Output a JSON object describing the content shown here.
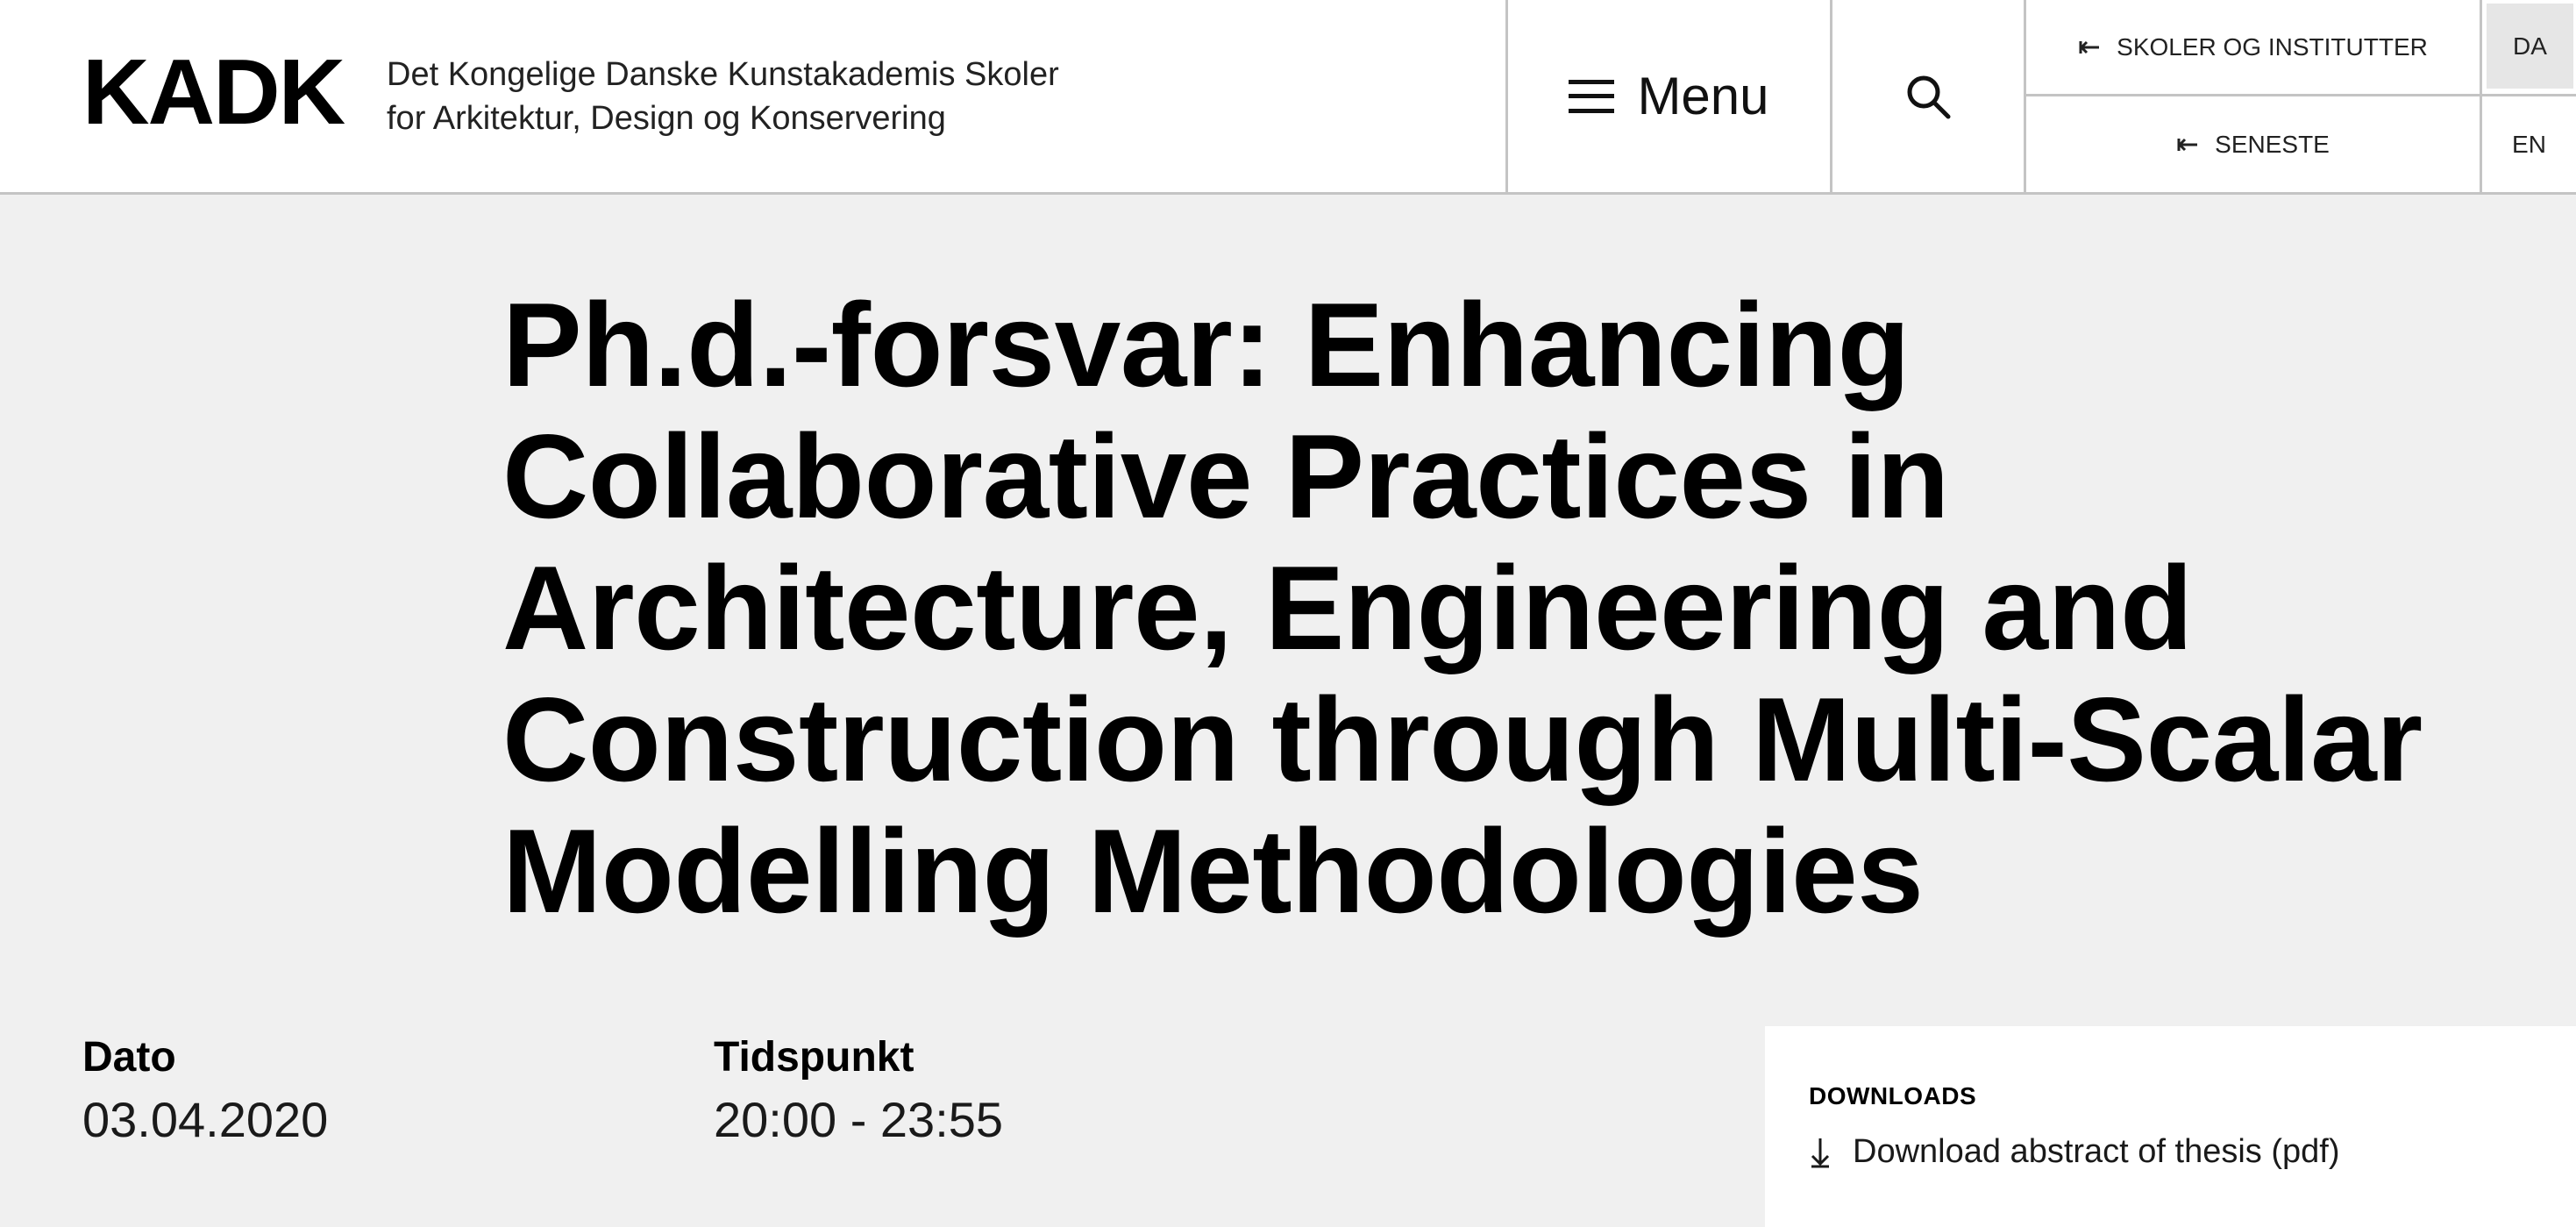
{
  "header": {
    "logo": "KADK",
    "tagline_line1": "Det Kongelige Danske Kunstakademis Skoler",
    "tagline_line2": "for Arkitektur, Design og Konservering",
    "menu_label": "Menu",
    "search_icon": "search-icon",
    "nav_schools": "SKOLER OG INSTITUTTER",
    "nav_latest": "SENESTE",
    "lang_da": "DA",
    "lang_en": "EN",
    "active_language": "DA"
  },
  "main": {
    "title": "Ph.d.-forsvar: Enhancing Collaborative Practices in Architecture, Engineering and Construction through Multi-Scalar Modelling Methodologies",
    "date_label": "Dato",
    "date_value": "03.04.2020",
    "time_label": "Tidspunkt",
    "time_value": "20:00 - 23:55"
  },
  "downloads": {
    "heading": "DOWNLOADS",
    "items": [
      {
        "label": "Download abstract of thesis (pdf)",
        "icon": "download-arrow-icon"
      }
    ]
  },
  "colors": {
    "header_bg": "#ffffff",
    "page_bg": "#f0f0f0",
    "divider": "#c4c4c4",
    "active_lang_bg": "#e6e6e6",
    "text": "#000000"
  }
}
